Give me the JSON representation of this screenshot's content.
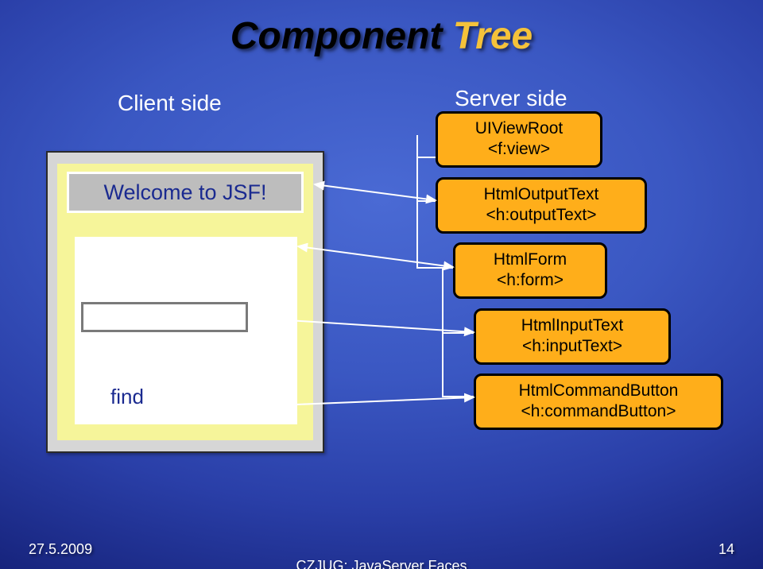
{
  "title_black": "Component",
  "title_yellow": " Tree",
  "labels": {
    "client": "Client side",
    "server": "Server side"
  },
  "client": {
    "welcome": "Welcome to JSF!",
    "find": "find"
  },
  "tree": {
    "root": {
      "class": "UIViewRoot",
      "tag": "<f:view>"
    },
    "output": {
      "class": "HtmlOutputText",
      "tag": "<h:outputText>"
    },
    "form": {
      "class": "HtmlForm",
      "tag": "<h:form>"
    },
    "input": {
      "class": "HtmlInputText",
      "tag": "<h:inputText>"
    },
    "button": {
      "class": "HtmlCommandButton",
      "tag": "<h:commandButton>"
    }
  },
  "footer": {
    "date": "27.5.2009",
    "mid": "CZJUG: JavaServer Faces",
    "page": "14"
  }
}
